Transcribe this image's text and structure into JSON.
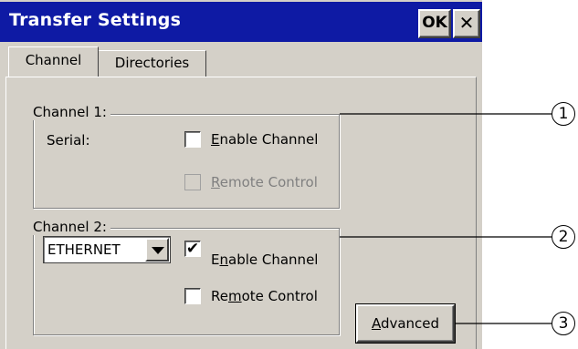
{
  "window": {
    "title": "Transfer Settings",
    "ok_label": "OK",
    "close_label": "✕"
  },
  "tabs": [
    {
      "label": "Channel",
      "active": true
    },
    {
      "label": "Directories",
      "active": false
    }
  ],
  "channel1": {
    "legend": "Channel 1:",
    "serial_label": "Serial:",
    "enable": {
      "pre": "",
      "mn": "E",
      "post": "nable Channel",
      "checked": false,
      "enabled": true
    },
    "remote": {
      "pre": "",
      "mn": "R",
      "post": "emote Control",
      "checked": false,
      "enabled": false
    }
  },
  "channel2": {
    "legend": "Channel 2:",
    "protocol_value": "ETHERNET",
    "enable": {
      "pre": "E",
      "mn": "n",
      "post": "able Channel",
      "checked": true,
      "enabled": true
    },
    "remote": {
      "pre": "Re",
      "mn": "m",
      "post": "ote Control",
      "checked": false,
      "enabled": true
    }
  },
  "advanced": {
    "pre": "",
    "mn": "A",
    "post": "dvanced"
  },
  "callouts": [
    "1",
    "2",
    "3"
  ],
  "colors": {
    "titlebar": "#0e1aa4",
    "face": "#d4d0c8",
    "disabled_text": "#808080"
  },
  "icons": {
    "check": "✔",
    "dropdown": "triangle-down"
  }
}
